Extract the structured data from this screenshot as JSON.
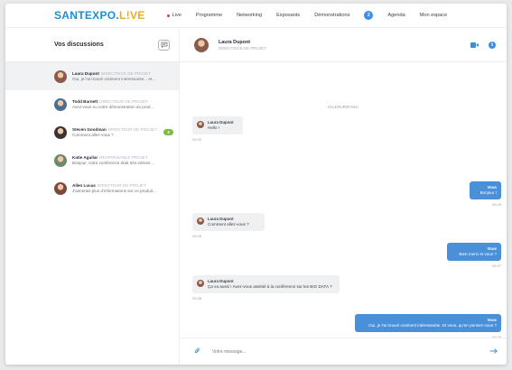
{
  "brand": {
    "part1": "SANTEXPO.",
    "part2": "L",
    "part3": "!",
    "part4": "VE"
  },
  "nav": {
    "live": "Live",
    "items": [
      "Programme",
      "Networking",
      "Exposants",
      "Démonstrations"
    ],
    "badge": "2",
    "items_after": [
      "Agenda",
      "Mon espace"
    ]
  },
  "sidebar": {
    "title": "Vos discussions",
    "conversations": [
      {
        "name": "Laura Dupont",
        "role": "DIRECTRICE DE PROJET",
        "preview": "Oui, je l'ai trouvé vraiment intéressante... et...",
        "avatar_color": "#8a5a4a",
        "active": true
      },
      {
        "name": "Todd Barnett",
        "role": "DIRECTEUR DE PROJET",
        "preview": "Avez-vous eu votre démonstration du prod...",
        "avatar_color": "#4d6f8f",
        "active": false
      },
      {
        "name": "Steven Goodman",
        "role": "DIRECTEUR DE PROJET",
        "preview": "Comment allez-vous ?",
        "avatar_color": "#3b3432",
        "active": false,
        "unread": "3"
      },
      {
        "name": "Katie Aguilar",
        "role": "RESPONSABLE PROJET",
        "preview": "Bonjour, votre conférence était très intéres...",
        "avatar_color": "#6b8a6a",
        "active": false
      },
      {
        "name": "Allen Lucas",
        "role": "DIRECTEUR DE PROJET",
        "preview": "J'aimerais plus d'informations sur ce produit...",
        "avatar_color": "#7a4b3a",
        "active": false
      }
    ]
  },
  "chat": {
    "contact_name": "Laura Dupont",
    "contact_role": "DIRECTRICE DE PROJET",
    "day_separator": "AUJOURD'HUI",
    "messages": [
      {
        "dir": "in",
        "sender": "Laura Dupont",
        "text": "Hello !",
        "time": "09:25"
      },
      {
        "dir": "out",
        "sender": "Vous",
        "text": "Bonjour !",
        "time": "09:25"
      },
      {
        "dir": "in",
        "sender": "Laura Dupont",
        "text": "Comment allez-vous ?",
        "time": "09:26"
      },
      {
        "dir": "out",
        "sender": "Vous",
        "text": "Bien merci et vous ?",
        "time": "09:27"
      },
      {
        "dir": "in",
        "sender": "Laura Dupont",
        "text": "Ça va aussi ! Avez-vous assisté à la conférence sur les BIG DATA ?",
        "time": "09:28"
      },
      {
        "dir": "out",
        "sender": "Vous",
        "text": "Oui, je l'ai trouvé vraiment intéressante. Et vous, qu'en pensez-vous ?",
        "time": "09:29"
      }
    ],
    "composer_placeholder": "Votre message..."
  }
}
